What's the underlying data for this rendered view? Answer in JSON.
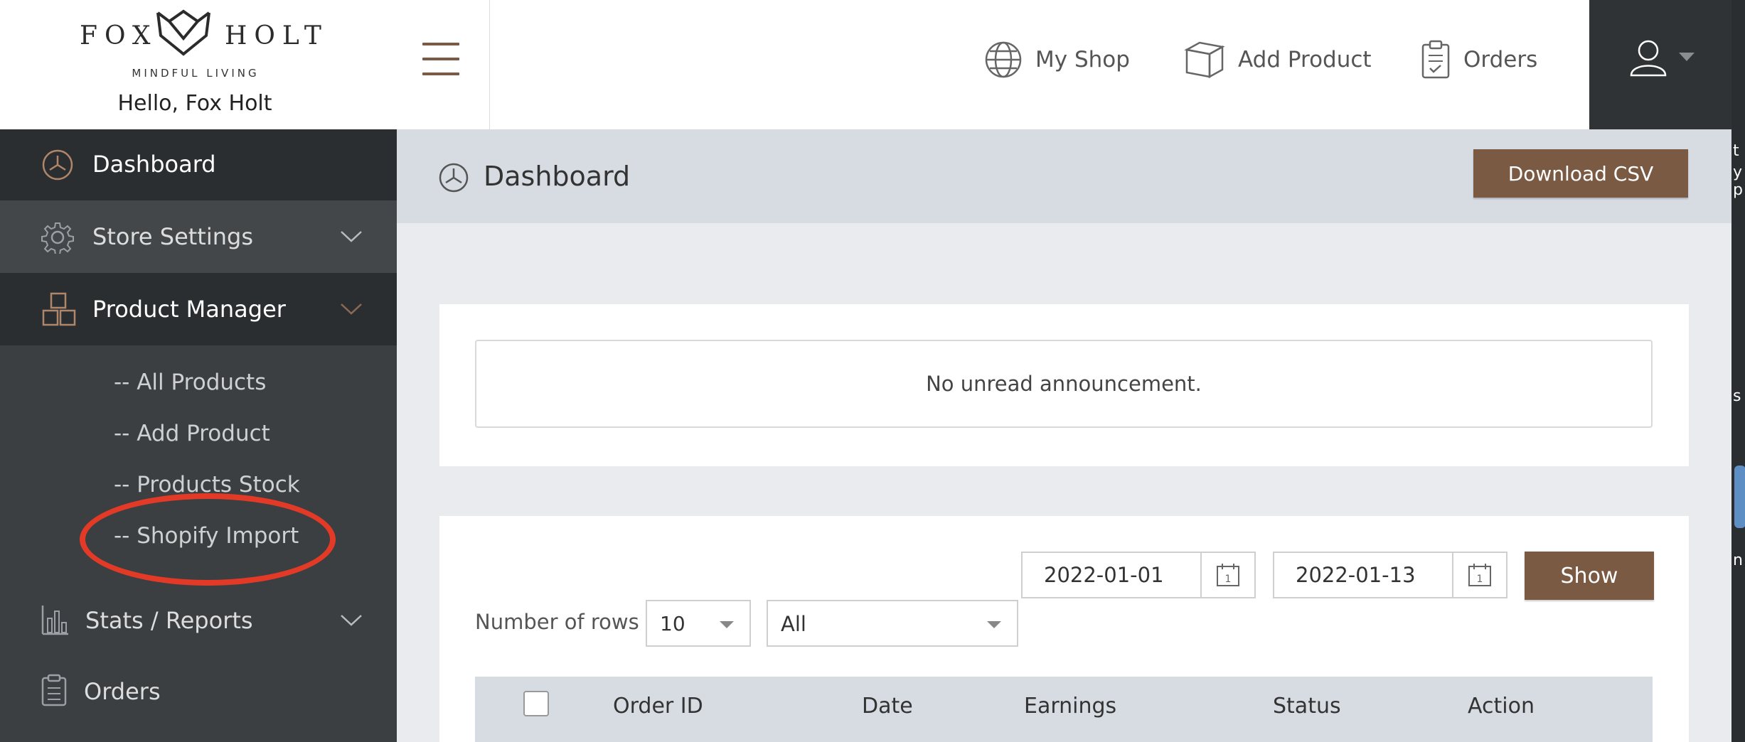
{
  "brand": {
    "logo_left": "FOX",
    "logo_right": "HOLT",
    "tagline": "MINDFUL LIVING",
    "greeting": "Hello, Fox Holt"
  },
  "top_nav": {
    "items": [
      {
        "label": "My Shop",
        "icon": "globe-icon"
      },
      {
        "label": "Add Product",
        "icon": "box-icon"
      },
      {
        "label": "Orders",
        "icon": "clipboard-icon"
      }
    ],
    "user_icon": "user-icon"
  },
  "sidebar": {
    "items": [
      {
        "label": "Dashboard",
        "icon": "dashboard-gauge-icon",
        "active": true
      },
      {
        "label": "Store Settings",
        "icon": "gear-icon"
      },
      {
        "label": "Product Manager",
        "icon": "boxes-icon",
        "expanded": true
      },
      {
        "label": "Stats / Reports",
        "icon": "bar-chart-icon"
      },
      {
        "label": "Orders",
        "icon": "clipboard-icon"
      }
    ],
    "sub_items": [
      "-- All Products",
      "-- Add Product",
      "-- Products Stock",
      "-- Shopify Import"
    ]
  },
  "main": {
    "title": "Dashboard",
    "download_csv": "Download CSV",
    "announcement": "No unread announcement.",
    "filters": {
      "date_from": "2022-01-01",
      "date_to": "2022-01-13",
      "show_label": "Show",
      "rows_label": "Number of rows",
      "rows_value": "10",
      "status_value": "All"
    },
    "table": {
      "columns": [
        "Order ID",
        "Date",
        "Earnings",
        "Status",
        "Action"
      ]
    }
  },
  "right_edge_fragments": [
    "t",
    "y p",
    "s",
    "n"
  ],
  "colors": {
    "accent_brown": "#7b5a43",
    "sidebar_bg": "#3b3f42",
    "sidebar_active": "#2b2e31",
    "annotation_red": "#e23a26"
  }
}
